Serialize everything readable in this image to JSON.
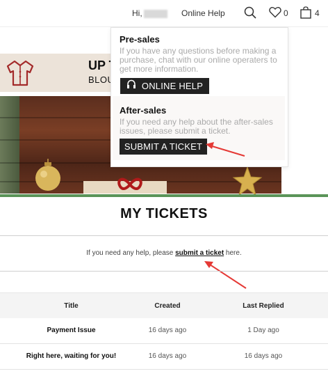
{
  "header": {
    "greeting": "Hi,",
    "online_help": "Online Help",
    "wishlist_count": "0",
    "bag_count": "4"
  },
  "banner": {
    "title": "UP T",
    "subtitle": "BLOU"
  },
  "dropdown": {
    "presales": {
      "heading": "Pre-sales",
      "text": "If you have any questions before making a purchase, chat with our online operaters to get more information.",
      "button": "ONLINE HELP"
    },
    "aftersales": {
      "heading": "After-sales",
      "text": "If you need any help about the after-sales issues, please submit a ticket.",
      "button": "SUBMIT A TICKET"
    }
  },
  "tickets": {
    "title": "MY TICKETS",
    "help_prefix": "If you need any help, please ",
    "help_link": "submit a ticket",
    "help_suffix": " here.",
    "columns": [
      "Title",
      "Created",
      "Last Replied"
    ],
    "rows": [
      {
        "title": "Payment Issue",
        "created": "16 days ago",
        "last_replied": "1 Day ago"
      },
      {
        "title": "Right here, waiting for you!",
        "created": "16 days ago",
        "last_replied": "16 days ago"
      }
    ]
  },
  "colors": {
    "arrow": "#e53935",
    "button_bg": "#222222",
    "separator": "#5a9458"
  }
}
